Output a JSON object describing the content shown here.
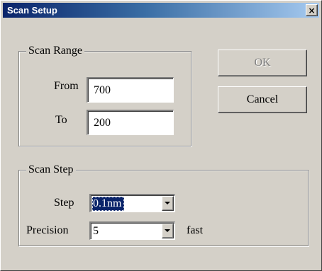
{
  "window": {
    "title": "Scan Setup",
    "close_glyph": "×",
    "close_icon": "close-icon"
  },
  "scan_range": {
    "title": "Scan Range",
    "from_label": "From",
    "from_value": "700",
    "to_label": "To",
    "to_value": "200"
  },
  "buttons": {
    "ok_label": "OK",
    "ok_enabled": false,
    "cancel_label": "Cancel"
  },
  "scan_step": {
    "title": "Scan Step",
    "step_label": "Step",
    "step_value": "0.1nm",
    "precision_label": "Precision",
    "precision_value": "5",
    "speed_label": "fast"
  },
  "colors": {
    "title_bar_start": "#0a246a",
    "title_bar_end": "#a6caf0",
    "dialog_face": "#d4d0c8",
    "selection": "#0a246a"
  }
}
